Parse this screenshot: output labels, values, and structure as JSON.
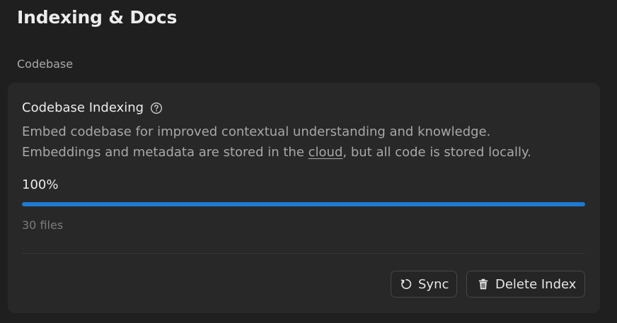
{
  "header": {
    "title": "Indexing & Docs"
  },
  "section": {
    "label": "Codebase"
  },
  "indexing_card": {
    "title": "Codebase Indexing",
    "help_icon": "question-circle-icon",
    "description_line1": "Embed codebase for improved contextual understanding and knowledge.",
    "description_line2_before": "Embeddings and metadata are stored in the ",
    "description_link": "cloud",
    "description_line2_after": ", but all code is stored locally.",
    "progress_label": "100%",
    "progress_fraction": 1.0,
    "files_count": "30 files",
    "sync_button": {
      "label": "Sync",
      "icon": "refresh-icon"
    },
    "delete_button": {
      "label": "Delete Index",
      "icon": "trash-icon"
    }
  },
  "colors": {
    "background": "#1f1f1f",
    "card": "#282828",
    "accent": "#1f7ad1"
  }
}
